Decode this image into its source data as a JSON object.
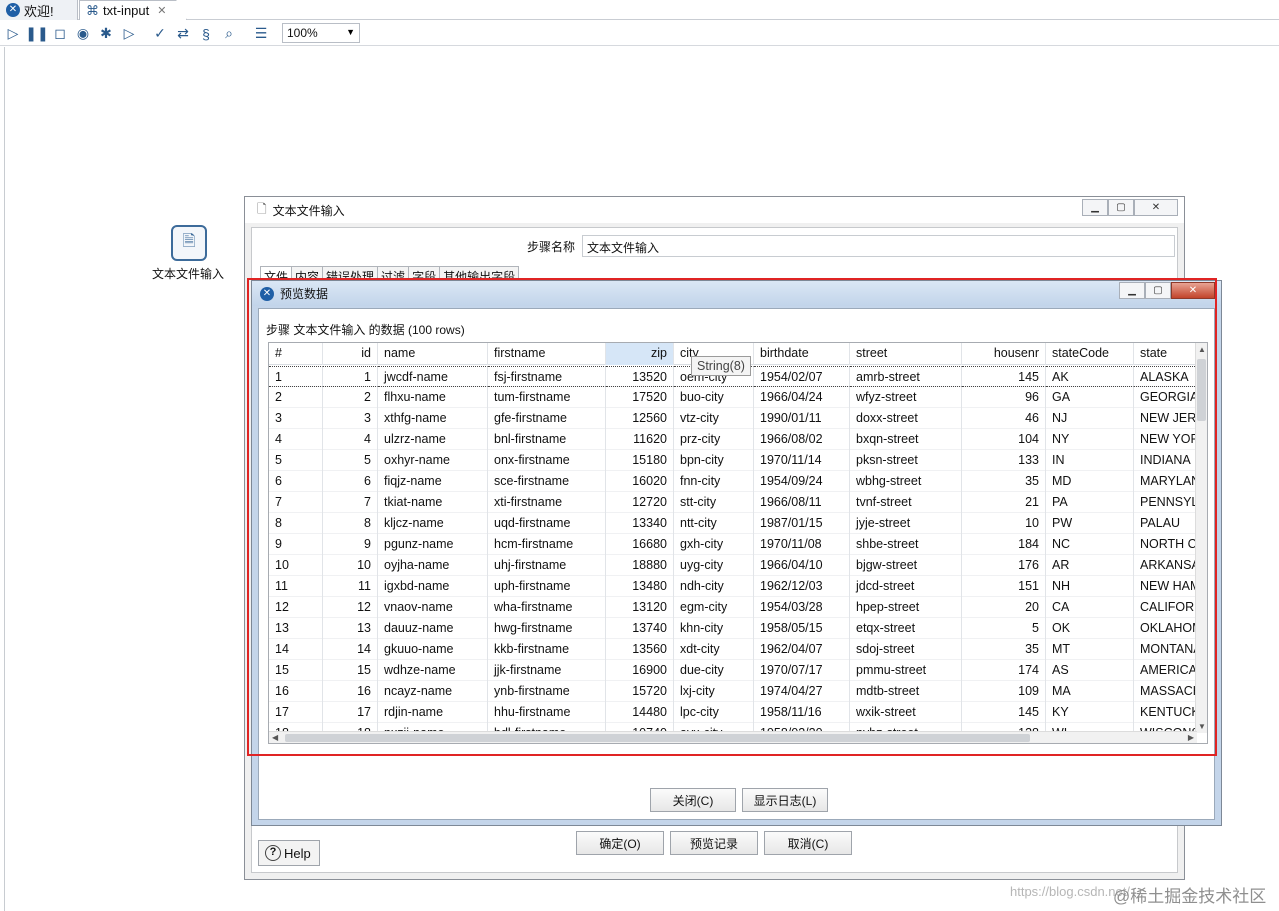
{
  "tabs": [
    {
      "label": "欢迎!",
      "closable": false
    },
    {
      "label": "txt-input",
      "closable": true
    }
  ],
  "toolbar": {
    "zoom_value": "100%"
  },
  "canvas": {
    "step_label": "文本文件输入"
  },
  "outer_dialog": {
    "title": "文本文件输入",
    "step_name_label": "步骤名称",
    "step_name_value": "文本文件输入",
    "tabs": [
      "文件",
      "内容",
      "错误处理",
      "过滤",
      "字段",
      "其他输出字段"
    ],
    "help_label": "Help",
    "ok_label": "确定(O)",
    "preview_label": "预览记录",
    "cancel_label": "取消(C)"
  },
  "preview_dialog": {
    "title": "预览数据",
    "caption": "步骤 文本文件输入 的数据  (100 rows)",
    "tooltip": "String(8)",
    "close_label": "关闭(C)",
    "show_log_label": "显示日志(L)",
    "columns": [
      "#",
      "id",
      "name",
      "firstname",
      "zip",
      "city",
      "birthdate",
      "street",
      "housenr",
      "stateCode",
      "state"
    ],
    "rows": [
      [
        "1",
        "1",
        "jwcdf-name",
        "fsj-firstname",
        "13520",
        "oem-city",
        "1954/02/07",
        "amrb-street",
        "145",
        "AK",
        "ALASKA"
      ],
      [
        "2",
        "2",
        "flhxu-name",
        "tum-firstname",
        "17520",
        "buo-city",
        "1966/04/24",
        "wfyz-street",
        "96",
        "GA",
        "GEORGIA"
      ],
      [
        "3",
        "3",
        "xthfg-name",
        "gfe-firstname",
        "12560",
        "vtz-city",
        "1990/01/11",
        "doxx-street",
        "46",
        "NJ",
        "NEW JERSE"
      ],
      [
        "4",
        "4",
        "ulzrz-name",
        "bnl-firstname",
        "11620",
        "prz-city",
        "1966/08/02",
        "bxqn-street",
        "104",
        "NY",
        "NEW YORK"
      ],
      [
        "5",
        "5",
        "oxhyr-name",
        "onx-firstname",
        "15180",
        "bpn-city",
        "1970/11/14",
        "pksn-street",
        "133",
        "IN",
        "INDIANA"
      ],
      [
        "6",
        "6",
        "fiqjz-name",
        "sce-firstname",
        "16020",
        "fnn-city",
        "1954/09/24",
        "wbhg-street",
        "35",
        "MD",
        "MARYLAND"
      ],
      [
        "7",
        "7",
        "tkiat-name",
        "xti-firstname",
        "12720",
        "stt-city",
        "1966/08/11",
        "tvnf-street",
        "21",
        "PA",
        "PENNSYLVA"
      ],
      [
        "8",
        "8",
        "kljcz-name",
        "uqd-firstname",
        "13340",
        "ntt-city",
        "1987/01/15",
        "jyje-street",
        "10",
        "PW",
        "PALAU"
      ],
      [
        "9",
        "9",
        "pgunz-name",
        "hcm-firstname",
        "16680",
        "gxh-city",
        "1970/11/08",
        "shbe-street",
        "184",
        "NC",
        "NORTH CA"
      ],
      [
        "10",
        "10",
        "oyjha-name",
        "uhj-firstname",
        "18880",
        "uyg-city",
        "1966/04/10",
        "bjgw-street",
        "176",
        "AR",
        "ARKANSAS"
      ],
      [
        "11",
        "11",
        "igxbd-name",
        "uph-firstname",
        "13480",
        "ndh-city",
        "1962/12/03",
        "jdcd-street",
        "151",
        "NH",
        "NEW HAMI"
      ],
      [
        "12",
        "12",
        "vnaov-name",
        "wha-firstname",
        "13120",
        "egm-city",
        "1954/03/28",
        "hpep-street",
        "20",
        "CA",
        "CALIFORNI"
      ],
      [
        "13",
        "13",
        "dauuz-name",
        "hwg-firstname",
        "13740",
        "khn-city",
        "1958/05/15",
        "etqx-street",
        "5",
        "OK",
        "OKLAHOMA"
      ],
      [
        "14",
        "14",
        "gkuuo-name",
        "kkb-firstname",
        "13560",
        "xdt-city",
        "1962/04/07",
        "sdoj-street",
        "35",
        "MT",
        "MONTANA"
      ],
      [
        "15",
        "15",
        "wdhze-name",
        "jjk-firstname",
        "16900",
        "due-city",
        "1970/07/17",
        "pmmu-street",
        "174",
        "AS",
        "AMERICAN"
      ],
      [
        "16",
        "16",
        "ncayz-name",
        "ynb-firstname",
        "15720",
        "lxj-city",
        "1974/04/27",
        "mdtb-street",
        "109",
        "MA",
        "MASSACHU"
      ],
      [
        "17",
        "17",
        "rdjin-name",
        "hhu-firstname",
        "14480",
        "lpc-city",
        "1958/11/16",
        "wxik-street",
        "145",
        "KY",
        "KENTUCKY"
      ],
      [
        "18",
        "18",
        "nxzij-name",
        "bdl-firstname",
        "10740",
        "avx-city",
        "1958/02/20",
        "nybz-street",
        "138",
        "WI",
        "WISCONSII"
      ]
    ]
  },
  "watermark": {
    "left": "https://blog.csdn.net/",
    "right": "@稀土掘金技术社区"
  }
}
